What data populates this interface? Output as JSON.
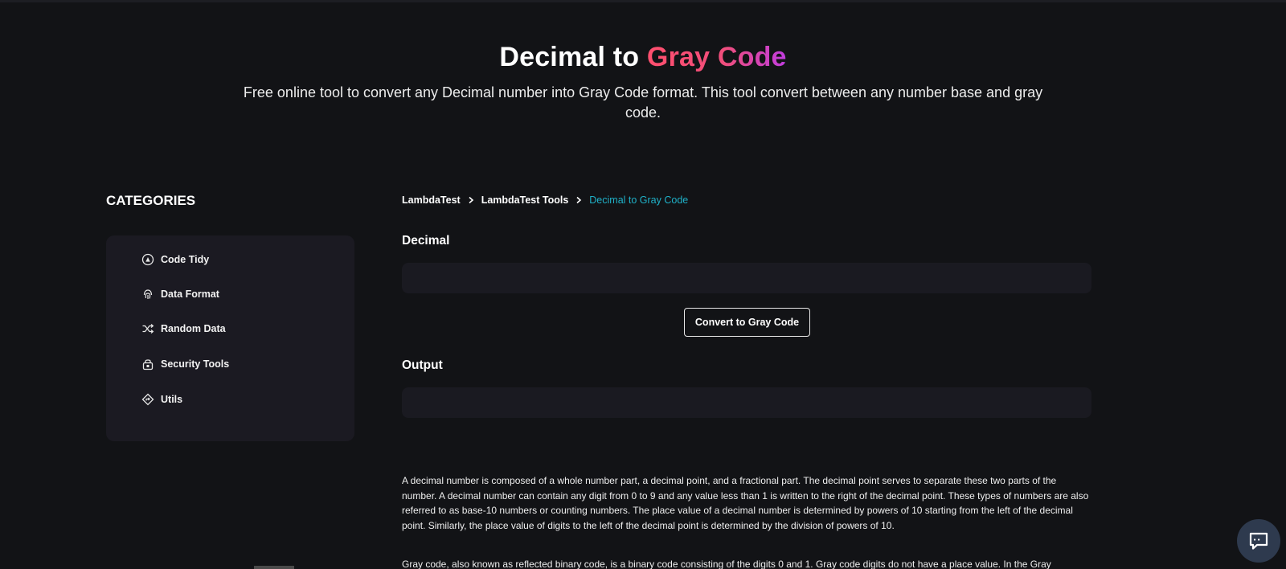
{
  "hero": {
    "title_plain": "Decimal to ",
    "title_accent": "Gray Code",
    "subtitle": "Free online tool to convert any Decimal number into Gray Code format. This tool convert between any number base and gray code."
  },
  "sidebar": {
    "heading": "CATEGORIES",
    "items": [
      {
        "label": "Code Tidy",
        "icon": "code-tidy-icon"
      },
      {
        "label": "Data Format",
        "icon": "fingerprint-icon"
      },
      {
        "label": "Random Data",
        "icon": "shuffle-icon"
      },
      {
        "label": "Security Tools",
        "icon": "lock-icon"
      },
      {
        "label": "Utils",
        "icon": "utils-icon"
      }
    ]
  },
  "breadcrumb": {
    "items": [
      "LambdaTest",
      "LambdaTest Tools"
    ],
    "current": "Decimal to Gray Code"
  },
  "form": {
    "input_label": "Decimal",
    "input_value": "",
    "button_label": "Convert to Gray Code",
    "output_label": "Output",
    "output_value": ""
  },
  "description": {
    "paragraph1": "A decimal number is composed of a whole number part, a decimal point, and a fractional part. The decimal point serves to separate these two parts of the number. A decimal number can contain any digit from 0 to 9 and any value less than 1 is written to the right of the decimal point. These types of numbers are also referred to as base-10 numbers or counting numbers. The place value of a decimal number is determined by powers of 10 starting from the left of the decimal point. Similarly, the place value of digits to the left of the decimal point is determined by the division of powers of 10.",
    "paragraph2": "Gray code, also known as reflected binary code, is a binary code consisting of the digits 0 and 1. Gray code digits do not have a place value. In the Gray"
  },
  "colors": {
    "background": "#121316",
    "panel": "#1b1a22",
    "accent_start": "#ff4f6e",
    "accent_end": "#c03ce0",
    "breadcrumb_current": "#1fb1c8"
  },
  "chat": {
    "icon": "chat-icon"
  }
}
